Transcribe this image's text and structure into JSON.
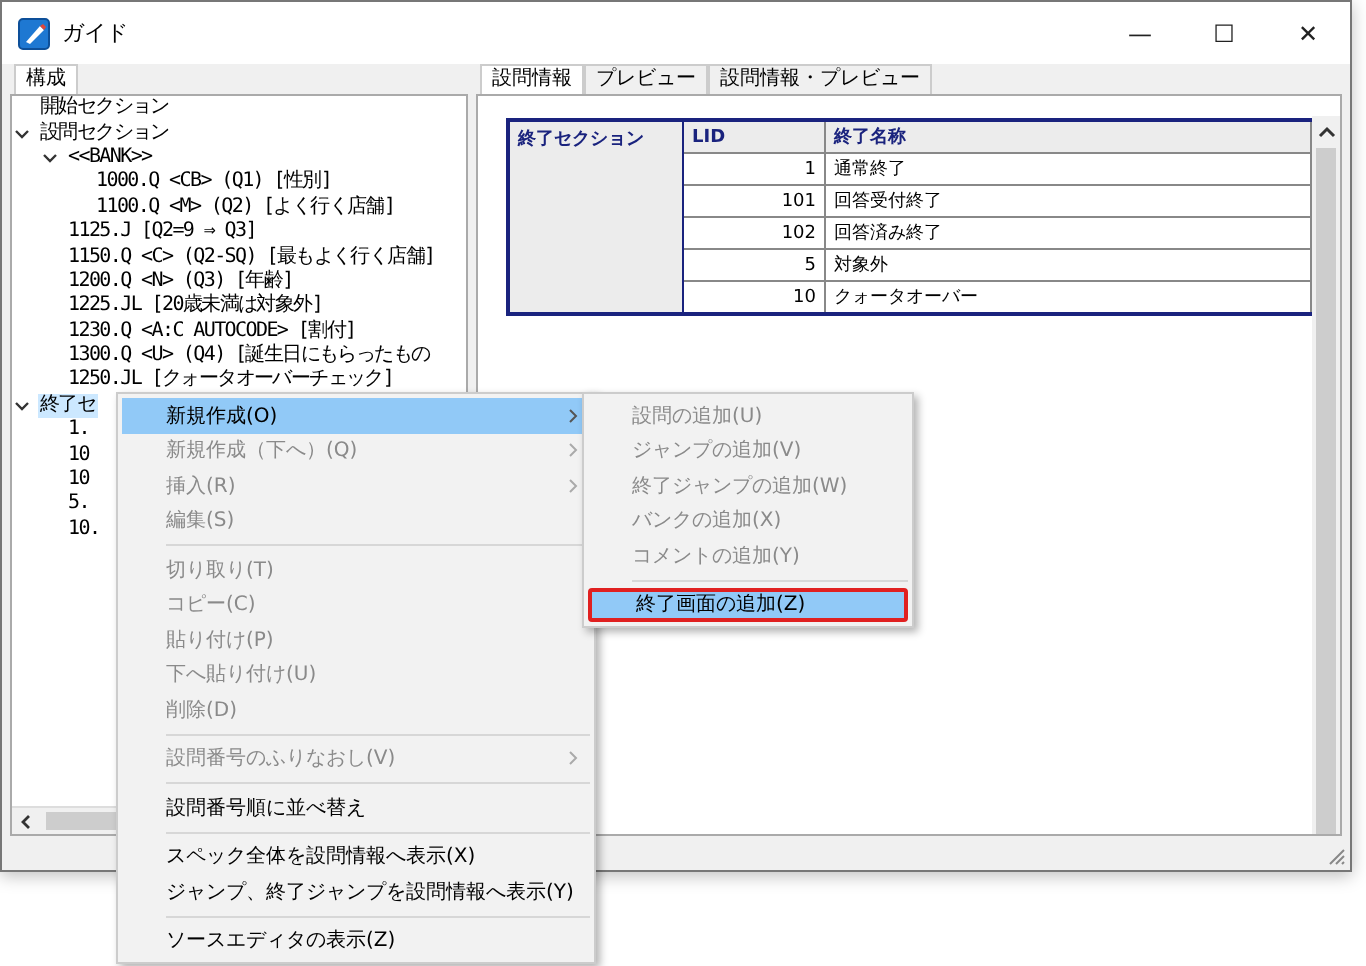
{
  "window": {
    "title": "ガイド",
    "controls": [
      "—",
      "☐",
      "✕"
    ]
  },
  "left_tabs": [
    {
      "label": "構成",
      "selected": true
    }
  ],
  "tree": [
    {
      "label": "開始セクション",
      "selected": false
    },
    {
      "label": "設問セクション",
      "expanded": true,
      "selected": false,
      "children": [
        {
          "label": "<<BANK>>",
          "expanded": true,
          "selected": false,
          "children": [
            {
              "label": "1000.Q <CB> (Q1) [性別]",
              "selected": false
            },
            {
              "label": "1100.Q <M> (Q2) [よく行く店舗]",
              "selected": false
            }
          ]
        },
        {
          "label": "1125.J  [Q2=9 ⇒  Q3]",
          "selected": false
        },
        {
          "label": "1150.Q <C> (Q2-SQ) [最もよく行く店舗]",
          "selected": false
        },
        {
          "label": "1200.Q <N> (Q3) [年齢]",
          "selected": false
        },
        {
          "label": "1225.JL  [20歳未満は対象外]",
          "selected": false
        },
        {
          "label": "1230.Q <A:C AUTOCODE> [割付]",
          "selected": false
        },
        {
          "label": "1300.Q <U> (Q4) [誕生日にもらったもの",
          "selected": false
        },
        {
          "label": "1250.JL  [クォータオーバーチェック]",
          "selected": false
        }
      ]
    },
    {
      "label": "終了セ",
      "expanded": true,
      "selected": true,
      "children": [
        {
          "label": "1.",
          "selected": false
        },
        {
          "label": "10",
          "selected": false
        },
        {
          "label": "10",
          "selected": false
        },
        {
          "label": "5.",
          "selected": false
        },
        {
          "label": "10.",
          "selected": false
        }
      ]
    }
  ],
  "right_tabs": [
    {
      "label": "設問情報",
      "selected": true
    },
    {
      "label": "プレビュー",
      "selected": false
    },
    {
      "label": "設問情報・プレビュー",
      "selected": false
    }
  ],
  "table": {
    "section_label": "終了セクション",
    "columns": [
      "LID",
      "終了名称"
    ],
    "rows": [
      {
        "lid": "1",
        "name": "通常終了"
      },
      {
        "lid": "101",
        "name": "回答受付終了"
      },
      {
        "lid": "102",
        "name": "回答済み終了"
      },
      {
        "lid": "5",
        "name": "対象外"
      },
      {
        "lid": "10",
        "name": "クォータオーバー"
      }
    ]
  },
  "context_menu": [
    {
      "kind": "item",
      "label": "新規作成(O)",
      "disabled": false,
      "selected": true,
      "submenu": true
    },
    {
      "kind": "item",
      "label": "新規作成（下へ）(Q)",
      "disabled": true,
      "selected": false,
      "submenu": true
    },
    {
      "kind": "item",
      "label": "挿入(R)",
      "disabled": true,
      "selected": false,
      "submenu": true
    },
    {
      "kind": "item",
      "label": "編集(S)",
      "disabled": true,
      "selected": false,
      "submenu": false
    },
    {
      "kind": "separator"
    },
    {
      "kind": "item",
      "label": "切り取り(T)",
      "disabled": true,
      "selected": false,
      "submenu": false
    },
    {
      "kind": "item",
      "label": "コピー(C)",
      "disabled": true,
      "selected": false,
      "submenu": false
    },
    {
      "kind": "item",
      "label": "貼り付け(P)",
      "disabled": true,
      "selected": false,
      "submenu": false
    },
    {
      "kind": "item",
      "label": "下へ貼り付け(U)",
      "disabled": true,
      "selected": false,
      "submenu": false
    },
    {
      "kind": "item",
      "label": "削除(D)",
      "disabled": true,
      "selected": false,
      "submenu": false
    },
    {
      "kind": "separator"
    },
    {
      "kind": "item",
      "label": "設問番号のふりなおし(V)",
      "disabled": true,
      "selected": false,
      "submenu": true
    },
    {
      "kind": "separator"
    },
    {
      "kind": "item",
      "label": "設問番号順に並べ替え",
      "disabled": false,
      "selected": false,
      "submenu": false
    },
    {
      "kind": "separator"
    },
    {
      "kind": "item",
      "label": "スペック全体を設問情報へ表示(X)",
      "disabled": false,
      "selected": false,
      "submenu": false
    },
    {
      "kind": "item",
      "label": "ジャンプ、終了ジャンプを設問情報へ表示(Y)",
      "disabled": false,
      "selected": false,
      "submenu": false
    },
    {
      "kind": "separator"
    },
    {
      "kind": "item",
      "label": "ソースエディタの表示(Z)",
      "disabled": false,
      "selected": false,
      "submenu": false
    }
  ],
  "submenu": [
    {
      "kind": "item",
      "label": "設問の追加(U)",
      "disabled": true,
      "selected": false,
      "outlined": false
    },
    {
      "kind": "item",
      "label": "ジャンプの追加(V)",
      "disabled": true,
      "selected": false,
      "outlined": false
    },
    {
      "kind": "item",
      "label": "終了ジャンプの追加(W)",
      "disabled": true,
      "selected": false,
      "outlined": false
    },
    {
      "kind": "item",
      "label": "バンクの追加(X)",
      "disabled": true,
      "selected": false,
      "outlined": false
    },
    {
      "kind": "item",
      "label": "コメントの追加(Y)",
      "disabled": true,
      "selected": false,
      "outlined": false
    },
    {
      "kind": "separator"
    },
    {
      "kind": "item",
      "label": "終了画面の追加(Z)",
      "disabled": false,
      "selected": true,
      "outlined": true
    }
  ]
}
